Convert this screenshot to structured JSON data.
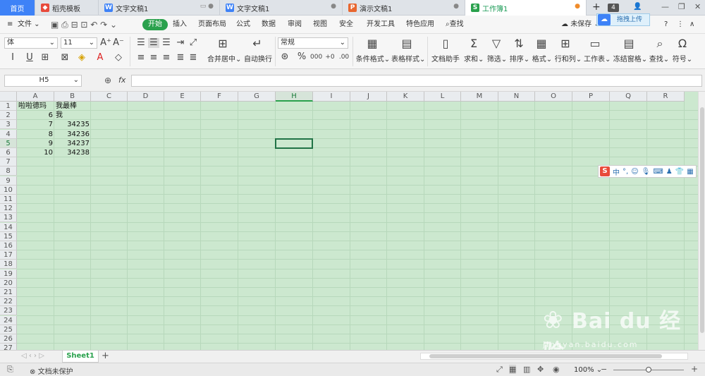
{
  "tabs": [
    {
      "label": "首页"
    },
    {
      "label": "稻壳模板",
      "icon": "docer-icon"
    },
    {
      "label": "文字文稿1",
      "icon": "W"
    },
    {
      "label": "文字文稿1",
      "icon": "W"
    },
    {
      "label": "演示文稿1",
      "icon": "P"
    },
    {
      "label": "工作簿1",
      "icon": "S"
    }
  ],
  "tab_count": "4",
  "cloud_tooltip": "拖拽上传",
  "menu": {
    "file": "文件",
    "start": "开始",
    "items": [
      "插入",
      "页面布局",
      "公式",
      "数据",
      "审阅",
      "视图",
      "安全",
      "开发工具",
      "特色应用"
    ],
    "search": "查找",
    "unsaved": "未保存"
  },
  "toolbar": {
    "font_name": "体",
    "font_size": "11",
    "number_format": "常规",
    "merge_center": "合并居中",
    "auto_wrap": "自动换行",
    "cond_format": "条件格式",
    "table_style": "表格样式",
    "doc_helper": "文档助手",
    "sum": "求和",
    "filter": "筛选",
    "sort": "排序",
    "format": "格式",
    "row_col": "行和列",
    "worksheet": "工作表",
    "freeze": "冻结窗格",
    "find": "查找",
    "symbol": "符号"
  },
  "formula": {
    "name_box": "H5",
    "fx": "fx",
    "value": ""
  },
  "columns": [
    "A",
    "B",
    "C",
    "D",
    "E",
    "F",
    "G",
    "H",
    "I",
    "J",
    "K",
    "L",
    "M",
    "N",
    "O",
    "P",
    "Q",
    "R"
  ],
  "selected_column": "H",
  "selected_row": 5,
  "rows": [
    "1",
    "2",
    "3",
    "4",
    "5",
    "6",
    "7",
    "8",
    "9",
    "10",
    "11",
    "12",
    "13",
    "14",
    "15",
    "16",
    "17",
    "18",
    "19",
    "20",
    "21",
    "22",
    "23",
    "24",
    "25",
    "26",
    "27"
  ],
  "cells": [
    {
      "ref": "A1",
      "value": "啦啦德玛"
    },
    {
      "ref": "B1",
      "value": "我最棒"
    },
    {
      "ref": "A2",
      "value": "6"
    },
    {
      "ref": "B2",
      "value": "我"
    },
    {
      "ref": "A3",
      "value": "7"
    },
    {
      "ref": "B3",
      "value": "34235"
    },
    {
      "ref": "A4",
      "value": "8"
    },
    {
      "ref": "B4",
      "value": "34236"
    },
    {
      "ref": "A5",
      "value": "9"
    },
    {
      "ref": "B5",
      "value": "34237"
    },
    {
      "ref": "A6",
      "value": "10"
    },
    {
      "ref": "B6",
      "value": "34238"
    }
  ],
  "ime_toolbar": {
    "brand": "S",
    "mode": "中"
  },
  "sheet_tab": "Sheet1",
  "status": {
    "protect": "文档未保护",
    "zoom": "100%"
  },
  "watermark": {
    "text": "Bai du 经验",
    "url": "jingyan.baidu.com"
  },
  "colors": {
    "accent": "#2aa14d",
    "grid_bg": "#cce8cf",
    "selection": "#217346"
  }
}
